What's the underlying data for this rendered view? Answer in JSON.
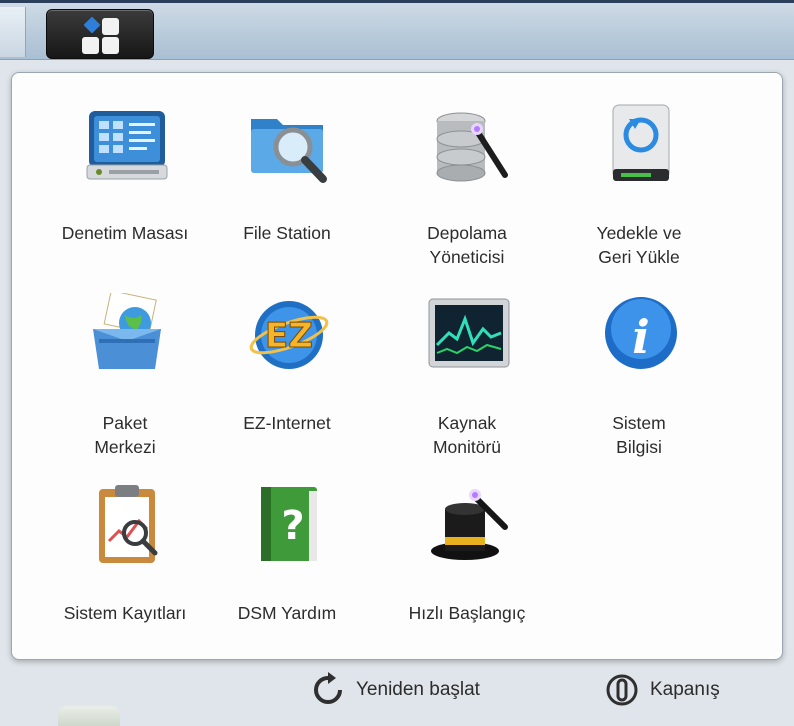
{
  "apps": [
    {
      "name": "app-denetim-masasi",
      "icon": "control-panel-icon",
      "label": "Denetim Masası"
    },
    {
      "name": "app-file-station",
      "icon": "folder-search-icon",
      "label": "File Station"
    },
    {
      "name": "app-depolama-yoneticisi",
      "icon": "storage-manager-icon",
      "label": "Depolama\nYöneticisi"
    },
    {
      "name": "app-yedekle",
      "icon": "backup-restore-icon",
      "label": "Yedekle ve\nGeri Yükle"
    },
    {
      "name": "app-paket-merkezi",
      "icon": "package-center-icon",
      "label": "Paket\nMerkezi"
    },
    {
      "name": "app-ez-internet",
      "icon": "ez-internet-icon",
      "label": "EZ-Internet"
    },
    {
      "name": "app-kaynak-monitoru",
      "icon": "resource-monitor-icon",
      "label": "Kaynak\nMonitörü"
    },
    {
      "name": "app-sistem-bilgisi",
      "icon": "info-icon",
      "label": "Sistem\nBilgisi"
    },
    {
      "name": "app-sistem-kayitlari",
      "icon": "log-clipboard-icon",
      "label": "Sistem Kayıtları"
    },
    {
      "name": "app-dsm-yardim",
      "icon": "help-book-icon",
      "label": "DSM Yardım"
    },
    {
      "name": "app-hizli-baslangic",
      "icon": "magic-hat-icon",
      "label": "Hızlı Başlangıç"
    }
  ],
  "actions": {
    "restart_label": "Yeniden başlat",
    "shutdown_label": "Kapanış"
  },
  "colors": {
    "taskbar": "#b9cbdb",
    "panel": "#fdfdfd",
    "text": "#2c2c2c",
    "accent_blue": "#2a7fd4"
  }
}
